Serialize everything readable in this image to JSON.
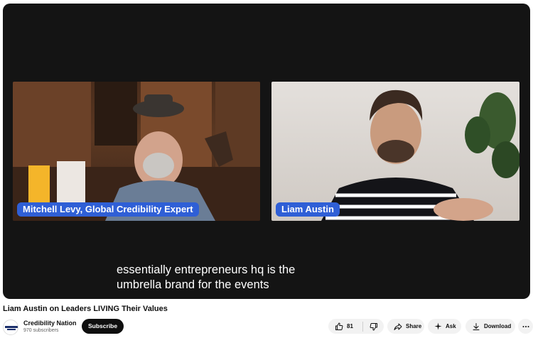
{
  "video": {
    "speakers": {
      "left": "Mitchell Levy, Global Credibility Expert",
      "right": "Liam Austin"
    },
    "caption_lines": [
      "essentially entrepreneurs hq is the",
      "umbrella brand for the events"
    ]
  },
  "title": "Liam Austin on Leaders LIVING Their Values",
  "channel": {
    "name": "Credibility Nation",
    "subscribers": "970 subscribers",
    "avatar_text": "CREDIBILITY NATION",
    "subscribe_label": "Subscribe"
  },
  "actions": {
    "like_count": "81",
    "share_label": "Share",
    "ask_label": "Ask",
    "download_label": "Download"
  },
  "colors": {
    "name_tag": "#2f5fd6",
    "player_bg": "#141414",
    "subscribe_bg": "#0f0f0f",
    "pill_bg": "#f2f2f2"
  }
}
